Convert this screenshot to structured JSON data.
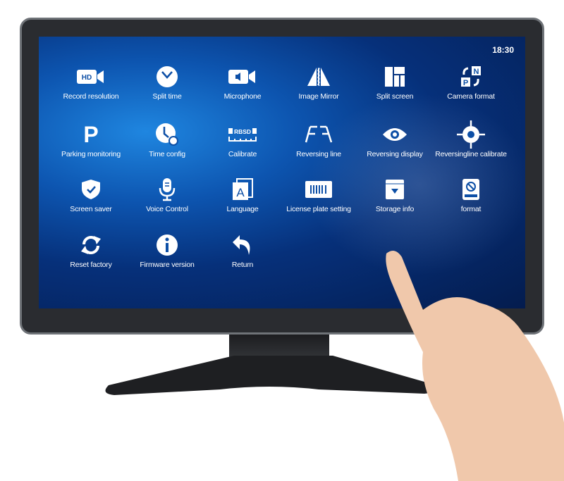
{
  "status": {
    "time": "18:30"
  },
  "menu": [
    {
      "label": "Record resolution",
      "icon": "hd-camera-icon"
    },
    {
      "label": "Split time",
      "icon": "clock-icon"
    },
    {
      "label": "Microphone",
      "icon": "audio-camera-icon"
    },
    {
      "label": "Image Mirror",
      "icon": "mirror-icon"
    },
    {
      "label": "Split screen",
      "icon": "split-screen-icon"
    },
    {
      "label": "Camera format",
      "icon": "camera-format-icon"
    },
    {
      "label": "Parking monitoring",
      "icon": "parking-icon"
    },
    {
      "label": "Time config",
      "icon": "time-config-icon"
    },
    {
      "label": "Calibrate",
      "icon": "rbsd-calibrate-icon"
    },
    {
      "label": "Reversing line",
      "icon": "reversing-line-icon"
    },
    {
      "label": "Reversing display",
      "icon": "eye-icon"
    },
    {
      "label": "Reversingline calibrate",
      "icon": "crosshair-icon"
    },
    {
      "label": "Screen saver",
      "icon": "shield-icon"
    },
    {
      "label": "Voice Control",
      "icon": "microphone-icon"
    },
    {
      "label": "Language",
      "icon": "language-icon"
    },
    {
      "label": "License plate setting",
      "icon": "license-plate-icon"
    },
    {
      "label": "Storage info",
      "icon": "storage-icon"
    },
    {
      "label": "format",
      "icon": "format-icon"
    },
    {
      "label": "Reset factory",
      "icon": "reset-icon"
    },
    {
      "label": "Firmware version",
      "icon": "info-icon"
    },
    {
      "label": "Return",
      "icon": "return-icon"
    }
  ],
  "icon_text": {
    "hd": "HD",
    "rbsd": "RBSD",
    "lang": "A",
    "n": "N",
    "p": "P",
    "parking": "P"
  },
  "colors": {
    "screen": "#0d55b0",
    "bezel": "#2a2c30",
    "icon": "#ffffff"
  }
}
